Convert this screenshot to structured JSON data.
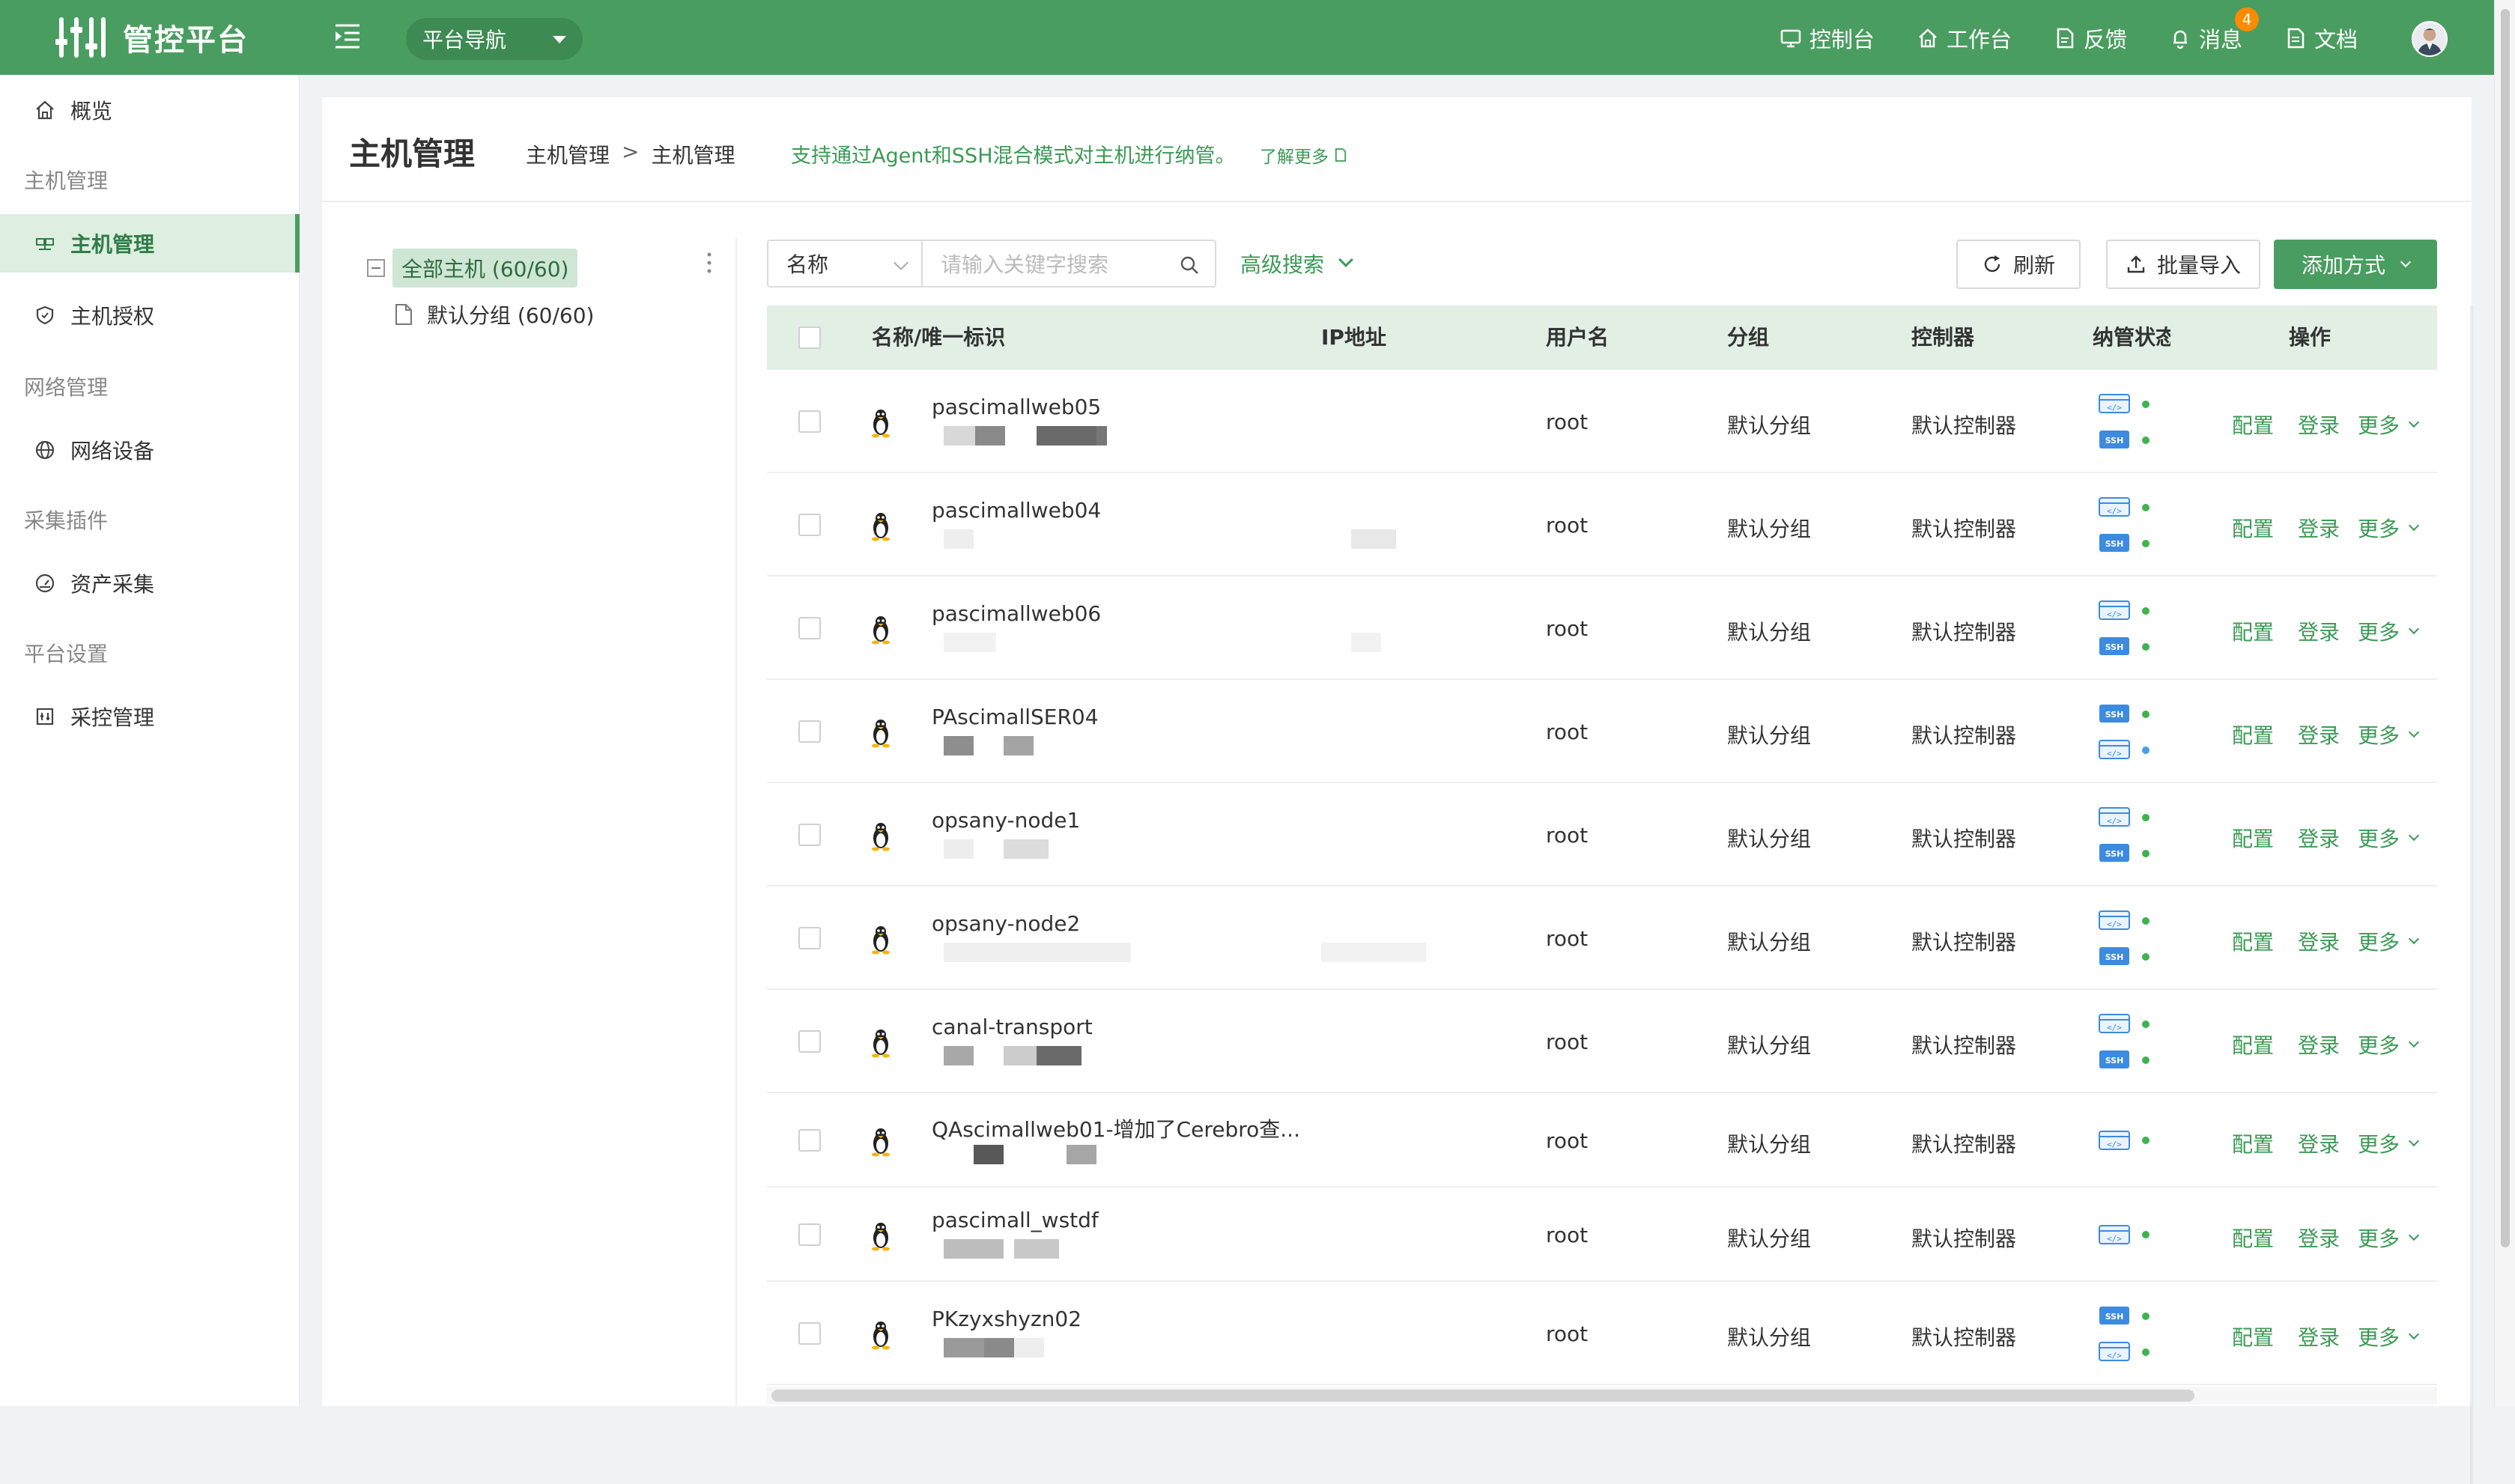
{
  "app": {
    "title": "管控平台"
  },
  "header": {
    "nav_select": "平台导航",
    "links": [
      {
        "label": "控制台",
        "icon": "monitor-icon"
      },
      {
        "label": "工作台",
        "icon": "home-icon"
      },
      {
        "label": "反馈",
        "icon": "feedback-icon"
      },
      {
        "label": "消息",
        "icon": "bell-icon",
        "badge": "4"
      },
      {
        "label": "文档",
        "icon": "document-icon"
      }
    ]
  },
  "sidebar": {
    "overview": "概览",
    "groups": [
      "主机管理",
      "网络管理",
      "采集插件",
      "平台设置"
    ],
    "items": [
      {
        "label": "主机管理",
        "icon": "host-icon",
        "active": true
      },
      {
        "label": "主机授权",
        "icon": "shield-icon"
      },
      {
        "label": "网络设备",
        "icon": "globe-icon"
      },
      {
        "label": "资产采集",
        "icon": "gauge-icon"
      },
      {
        "label": "采控管理",
        "icon": "control-icon"
      }
    ]
  },
  "page": {
    "title": "主机管理",
    "breadcrumb": [
      "主机管理",
      "主机管理"
    ],
    "breadcrumb_sep": ">",
    "tip": "支持通过Agent和SSH混合模式对主机进行纳管。",
    "learn_more": "了解更多"
  },
  "tree": {
    "root": "全部主机 (60/60)",
    "child": "默认分组 (60/60)"
  },
  "search": {
    "field": "名称",
    "placeholder": "请输入关键字搜索",
    "advanced": "高级搜索"
  },
  "toolbar": {
    "refresh": "刷新",
    "import": "批量导入",
    "add": "添加方式"
  },
  "table": {
    "columns": [
      "名称/唯一标识",
      "IP地址",
      "用户名",
      "分组",
      "控制器",
      "纳管状态",
      "操作"
    ],
    "actions": {
      "config": "配置",
      "login": "登录",
      "more": "更多"
    },
    "rows": [
      {
        "name": "pascimallweb05",
        "user": "root",
        "group": "默认分组",
        "controller": "默认控制器",
        "modes": [
          "agent",
          "ssh"
        ]
      },
      {
        "name": "pascimallweb04",
        "user": "root",
        "group": "默认分组",
        "controller": "默认控制器",
        "modes": [
          "agent",
          "ssh"
        ]
      },
      {
        "name": "pascimallweb06",
        "user": "root",
        "group": "默认分组",
        "controller": "默认控制器",
        "modes": [
          "agent",
          "ssh"
        ]
      },
      {
        "name": "PAscimallSER04",
        "user": "root",
        "group": "默认分组",
        "controller": "默认控制器",
        "modes": [
          "ssh",
          "agent"
        ]
      },
      {
        "name": "opsany-node1",
        "user": "root",
        "group": "默认分组",
        "controller": "默认控制器",
        "modes": [
          "agent",
          "ssh"
        ]
      },
      {
        "name": "opsany-node2",
        "user": "root",
        "group": "默认分组",
        "controller": "默认控制器",
        "modes": [
          "agent",
          "ssh"
        ]
      },
      {
        "name": "canal-transport",
        "user": "root",
        "group": "默认分组",
        "controller": "默认控制器",
        "modes": [
          "agent",
          "ssh"
        ]
      },
      {
        "name": "QAscimallweb01-增加了Cerebro查...",
        "user": "root",
        "group": "默认分组",
        "controller": "默认控制器",
        "modes": [
          "agent"
        ]
      },
      {
        "name": "pascimall_wstdf",
        "user": "root",
        "group": "默认分组",
        "controller": "默认控制器",
        "modes": [
          "agent"
        ]
      },
      {
        "name": "PKzyxshyzn02",
        "user": "root",
        "group": "默认分组",
        "controller": "默认控制器",
        "modes": [
          "ssh",
          "agent"
        ]
      }
    ]
  },
  "colors": {
    "primary": "#4a9d60",
    "accent_text": "#3b9a55",
    "badge": "#ff8a00"
  }
}
